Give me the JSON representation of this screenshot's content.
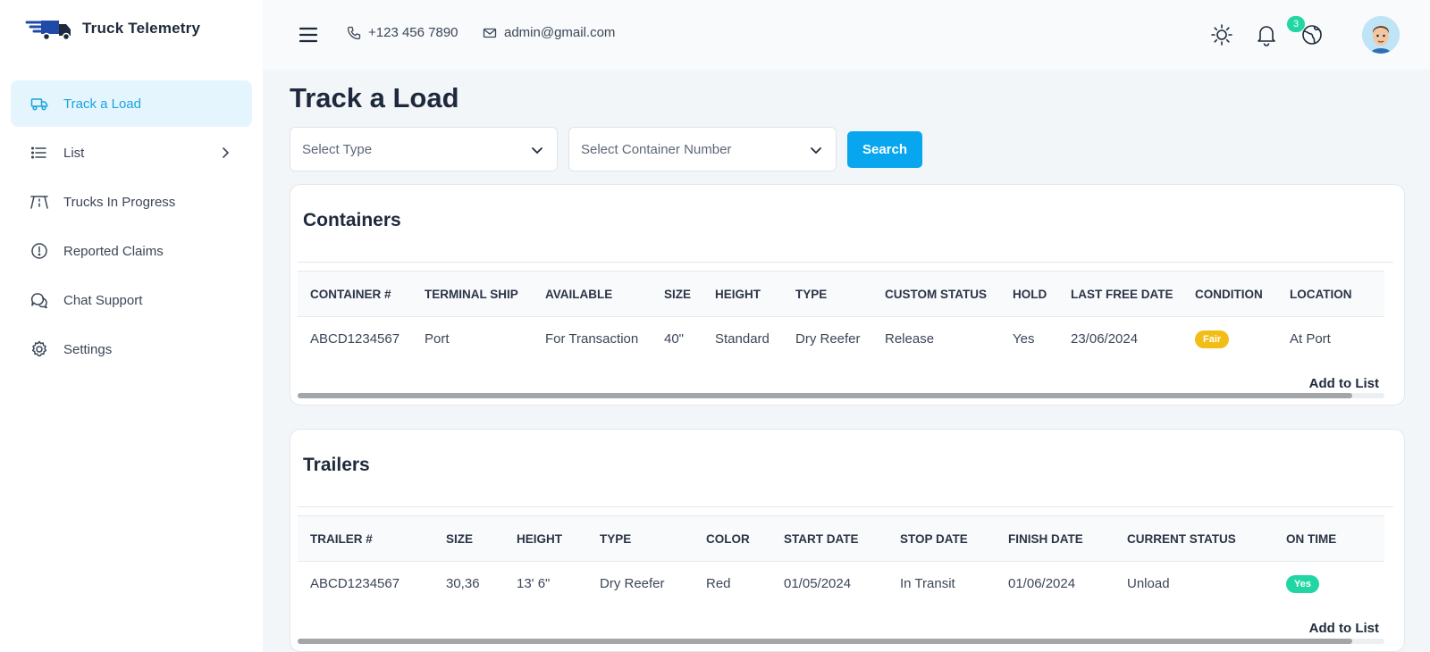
{
  "brand": {
    "name": "Truck Telemetry",
    "logo_icon": "truck-logo-icon"
  },
  "sidebar": {
    "items": [
      {
        "label": "Track a Load",
        "icon": "truck-icon",
        "active": true
      },
      {
        "label": "List",
        "icon": "list-icon",
        "has_submenu": true
      },
      {
        "label": "Trucks In Progress",
        "icon": "road-icon"
      },
      {
        "label": "Reported Claims",
        "icon": "alert-circle-icon"
      },
      {
        "label": "Chat Support",
        "icon": "chat-icon"
      },
      {
        "label": "Settings",
        "icon": "gear-icon"
      }
    ]
  },
  "header": {
    "phone": "+123 456 7890",
    "email": "admin@gmail.com",
    "notification_count": "3",
    "icons": [
      "menu-icon",
      "sun-icon",
      "bell-icon",
      "globe-icon",
      "avatar"
    ]
  },
  "main": {
    "title": "Track a Load",
    "filters": {
      "type_placeholder": "Select Type",
      "container_placeholder": "Select Container Number",
      "search_label": "Search"
    }
  },
  "containers": {
    "title": "Containers",
    "columns": [
      "CONTAINER #",
      "TERMINAL SHIP",
      "AVAILABLE",
      "SIZE",
      "HEIGHT",
      "TYPE",
      "CUSTOM STATUS",
      "HOLD",
      "LAST FREE DATE",
      "CONDITION",
      "LOCATION"
    ],
    "rows": [
      [
        "ABCD1234567",
        "Port",
        "For Transaction",
        "40\"",
        "Standard",
        "Dry Reefer",
        "Release",
        "Yes",
        "23/06/2024",
        "Fair",
        "At Port"
      ]
    ],
    "add_label": "Add to List",
    "scroll_fraction": 0.97
  },
  "trailers": {
    "title": "Trailers",
    "columns": [
      "TRAILER #",
      "SIZE",
      "HEIGHT",
      "TYPE",
      "COLOR",
      "START DATE",
      "STOP DATE",
      "FINISH DATE",
      "CURRENT STATUS",
      "ON TIME"
    ],
    "rows": [
      [
        "ABCD1234567",
        "30,36",
        "13' 6\"",
        "Dry Reefer",
        "Red",
        "01/05/2024",
        "In Transit",
        "01/06/2024",
        "Unload",
        "Yes"
      ]
    ],
    "add_label": "Add to List",
    "scroll_fraction": 0.97
  },
  "colors": {
    "accent": "#08a6ef",
    "fair": "#f2bd17",
    "yes": "#22d6a3",
    "active_bg": "#e5f5fd"
  }
}
